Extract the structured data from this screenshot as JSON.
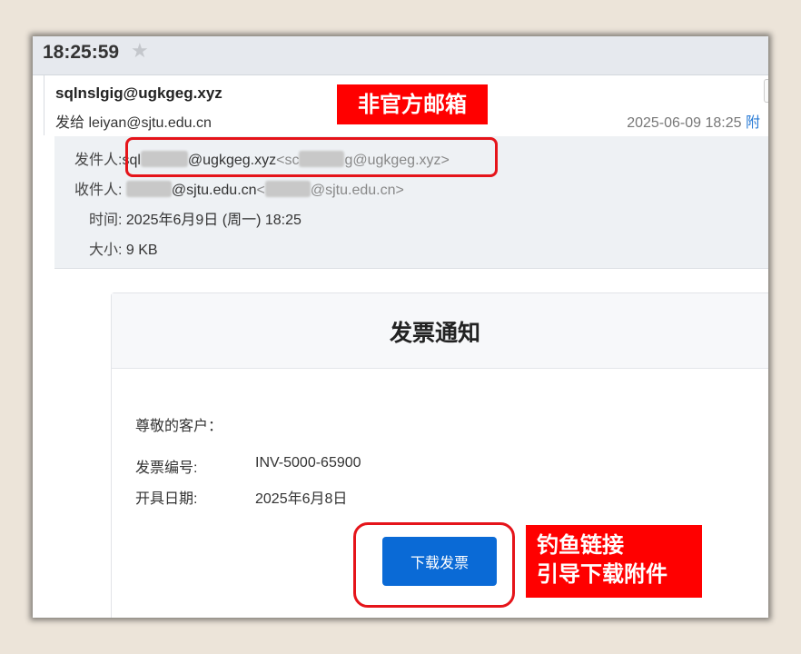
{
  "titlebar": {
    "time": "18:25:59",
    "star_icon": "star-icon"
  },
  "header": {
    "from_address": "sqlnslgig@ugkgeg.xyz",
    "to_line": "发给 leiyan@sjtu.edu.cn",
    "date": "2025-06-09 18:25",
    "date_tail": "附"
  },
  "details": {
    "sender_label": "发件人:",
    "sender_prefix": "sql",
    "sender_domain": "@ugkgeg.xyz",
    "sender_bracket_open": "<",
    "sender_mid_prefix": "sc",
    "sender_mid_suffix": "g@ugkgeg.xyz",
    "sender_bracket_close": ">",
    "recipient_label": "收件人:",
    "recipient_domain": "@sjtu.edu.cn",
    "recipient_bracket_open": "<",
    "recipient_domain2": "@sjtu.edu.cn",
    "recipient_bracket_close": ">",
    "time_label": "时间:",
    "time_value": "2025年6月9日 (周一) 18:25",
    "size_label": "大小:",
    "size_value": "9 KB"
  },
  "body": {
    "title": "发票通知",
    "greeting": "尊敬的客户：",
    "invoice_no_label": "发票编号:",
    "invoice_no_value": "INV-5000-65900",
    "issue_date_label": "开具日期:",
    "issue_date_value": "2025年6月8日",
    "download_button": "下载发票"
  },
  "annotations": {
    "unofficial_mailbox": "非官方邮箱",
    "phishing_line1": "钓鱼链接",
    "phishing_line2": "引导下载附件",
    "highlight_color": "#e5141a",
    "tag_color": "#ff0000"
  }
}
